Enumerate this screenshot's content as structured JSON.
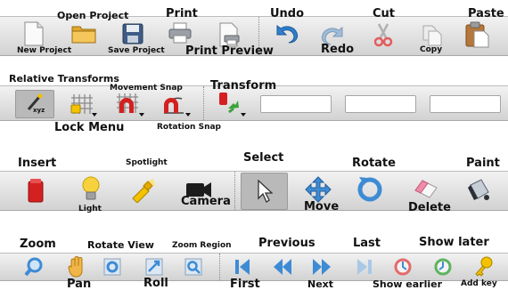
{
  "file_toolbar": {
    "new_project": "New Project",
    "open_project": "Open Project",
    "save_project": "Save Project",
    "print": "Print",
    "print_preview": "Print Preview",
    "undo": "Undo",
    "redo": "Redo",
    "cut": "Cut",
    "copy": "Copy",
    "paste": "Paste"
  },
  "transform_toolbar": {
    "relative_transforms": "Relative Transforms",
    "lock_menu": "Lock Menu",
    "movement_snap": "Movement Snap",
    "rotation_snap": "Rotation Snap",
    "transform": "Transform",
    "xyz_badge": "xyz",
    "field_1": "",
    "field_2": "",
    "field_3": ""
  },
  "object_toolbar": {
    "insert": "Insert",
    "light": "Light",
    "spotlight": "Spotlight",
    "camera": "Camera",
    "select": "Select",
    "move": "Move",
    "rotate": "Rotate",
    "delete": "Delete",
    "paint": "Paint"
  },
  "view_toolbar": {
    "zoom": "Zoom",
    "pan": "Pan",
    "rotate_view": "Rotate View",
    "roll": "Roll",
    "zoom_region": "Zoom Region",
    "previous": "Previous",
    "first": "First",
    "next": "Next",
    "last": "Last",
    "show_later": "Show later",
    "show_earlier": "Show earlier",
    "add_key": "Add key"
  },
  "colors": {
    "toolbar_top": "#f2f2f2",
    "toolbar_bottom": "#d2d2d2",
    "accent_blue": "#3d8bd4",
    "undo_blue": "#2f7fcc",
    "red": "#d42020",
    "yellow": "#f5c200",
    "selected_button": "#b9b9b9"
  }
}
